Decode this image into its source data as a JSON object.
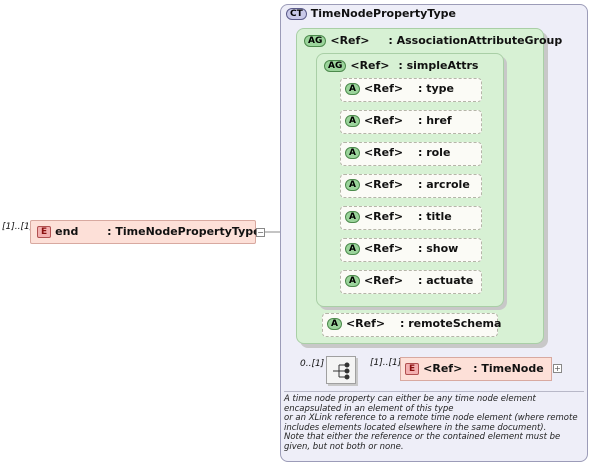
{
  "complex_type": {
    "badge": "CT",
    "name": "TimeNodePropertyType"
  },
  "element": {
    "occurrence": "[1]..[1]",
    "badge": "E",
    "name": "end",
    "type": ": TimeNodePropertyType"
  },
  "groups": {
    "association": {
      "badge": "AG",
      "ref": "<Ref>",
      "name": ": AssociationAttributeGroup"
    },
    "simple": {
      "badge": "AG",
      "ref": "<Ref>",
      "name": ": simpleAttrs"
    }
  },
  "attributes": [
    {
      "badge": "A",
      "ref": "<Ref>",
      "name": ": type"
    },
    {
      "badge": "A",
      "ref": "<Ref>",
      "name": ": href"
    },
    {
      "badge": "A",
      "ref": "<Ref>",
      "name": ": role"
    },
    {
      "badge": "A",
      "ref": "<Ref>",
      "name": ": arcrole"
    },
    {
      "badge": "A",
      "ref": "<Ref>",
      "name": ": title"
    },
    {
      "badge": "A",
      "ref": "<Ref>",
      "name": ": show"
    },
    {
      "badge": "A",
      "ref": "<Ref>",
      "name": ": actuate"
    }
  ],
  "remote_schema": {
    "badge": "A",
    "ref": "<Ref>",
    "name": ": remoteSchema"
  },
  "choice": {
    "occurrence": "0..[1]"
  },
  "time_node": {
    "occurrence": "[1]..[1]",
    "badge": "E",
    "ref": "<Ref>",
    "name": ": TimeNode"
  },
  "documentation": [
    "A time node property can either be any time node element encapsulated in an element of this type",
    "or an XLink reference to a remote time node element (where remote includes elements located elsewhere in the same document).",
    "Note that either the reference or the contained element must be given, but not both or none."
  ]
}
